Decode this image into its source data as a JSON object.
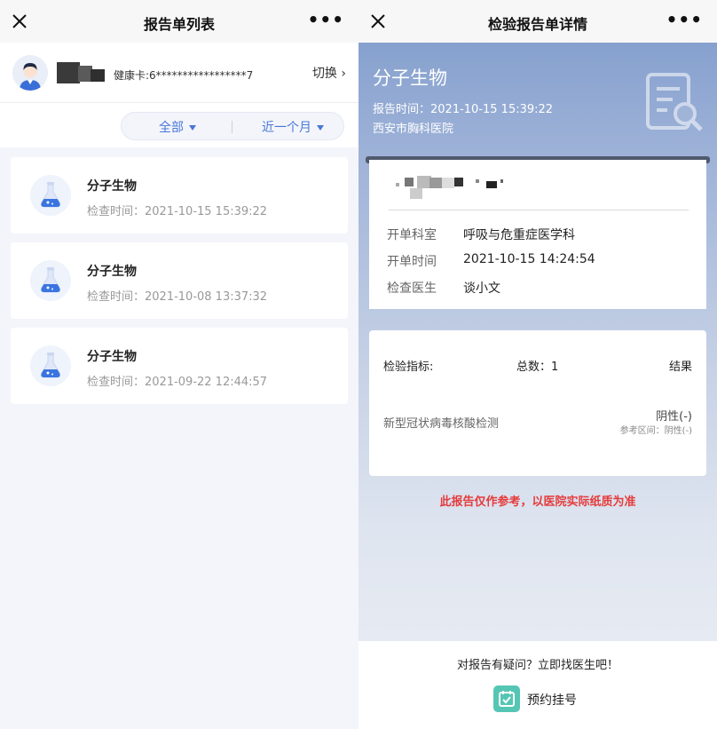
{
  "left_panel": {
    "navbar": {
      "title": "报告单列表",
      "more_label": "•••"
    },
    "user": {
      "health_card": "健康卡:6*****************7",
      "switch_label": "切换 ›"
    },
    "filters": {
      "category": "全部",
      "range": "近一个月"
    },
    "reports": [
      {
        "title": "分子生物",
        "time": "检查时间：2021-10-15 15:39:22"
      },
      {
        "title": "分子生物",
        "time": "检查时间：2021-10-08 13:37:32"
      },
      {
        "title": "分子生物",
        "time": "检查时间：2021-09-22 12:44:57"
      }
    ]
  },
  "right_panel": {
    "navbar": {
      "title": "检验报告单详情",
      "more_label": "•••"
    },
    "hero": {
      "title": "分子生物",
      "report_time": "报告时间：2021-10-15 15:39:22",
      "hospital": "西安市胸科医院"
    },
    "info": {
      "rows": [
        {
          "label": "开单科室",
          "value": "呼吸与危重症医学科"
        },
        {
          "label": "开单时间",
          "value": "2021-10-15 14:24:54"
        },
        {
          "label": "检查医生",
          "value": "谈小文"
        }
      ]
    },
    "results": {
      "header_index": "检验指标:",
      "header_total": "总数：1",
      "header_result": "结果",
      "item_name": "新型冠状病毒核酸检测",
      "item_value": "阴性(-)",
      "item_reference": "参考区间：阴性(-)"
    },
    "disclaimer": "此报告仅作参考，以医院实际纸质为准",
    "bottom": {
      "question": "对报告有疑问？立即找医生吧！",
      "book_label": "预约挂号"
    }
  },
  "colors": {
    "accent_blue": "#4a76d8",
    "warning_red": "#e53b3b",
    "teal": "#56c6b4"
  }
}
